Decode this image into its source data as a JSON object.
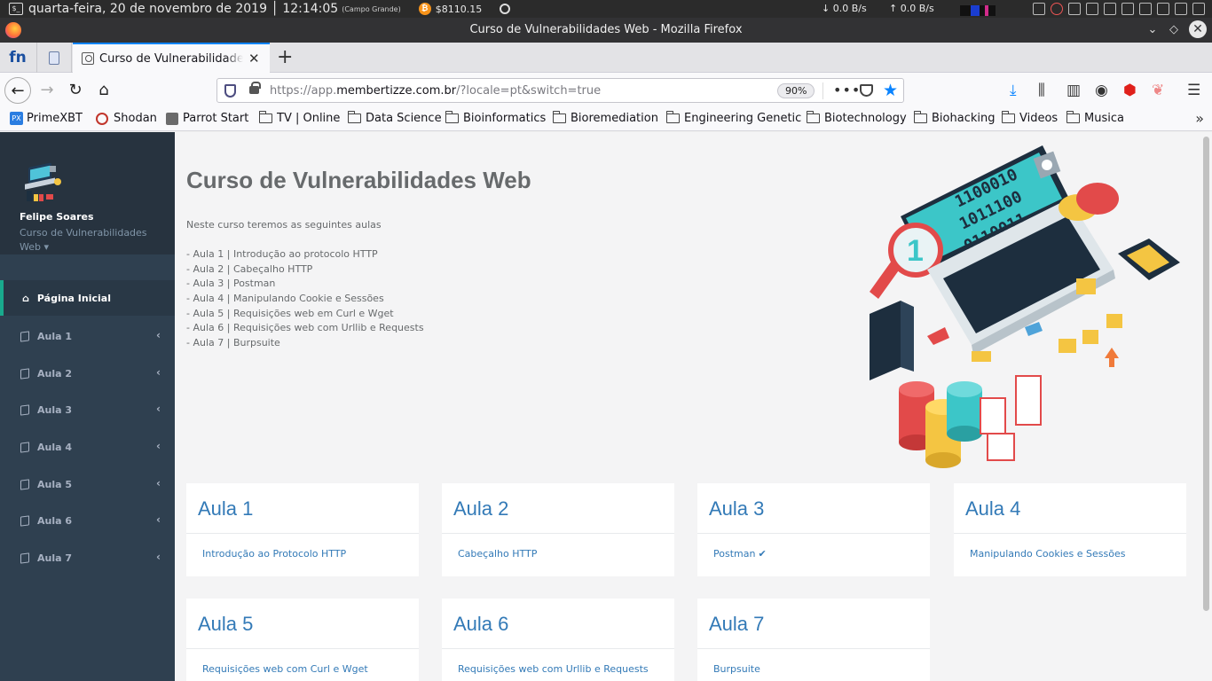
{
  "os_panel": {
    "datetime": "quarta-feira, 20 de novembro de 2019 │ 12:14:05",
    "timezone": "(Campo Grande)",
    "btc_value": "$8110.15",
    "net_down": "↓  0.0 B/s",
    "net_up": "↑  0.0 B/s"
  },
  "window": {
    "title": "Curso de Vulnerabilidades Web - Mozilla Firefox"
  },
  "tabs": {
    "pinned_fn_label": "fn",
    "active_title": "Curso de Vulnerabilidades Web",
    "close": "✕",
    "new_tab": "+"
  },
  "navbar": {
    "url_prefix": "https://app.",
    "url_domain": "membertizze.com.br",
    "url_path": "/?locale=pt&switch=true",
    "zoom": "90%",
    "more": "•••"
  },
  "bookmarks": [
    {
      "label": "PrimeXBT",
      "icon": "primexbt-icon"
    },
    {
      "label": "Shodan",
      "icon": "shodan-icon"
    },
    {
      "label": "Parrot Start",
      "icon": "parrot-icon"
    },
    {
      "label": "TV | Online",
      "icon": "folder-icon"
    },
    {
      "label": "Data Science",
      "icon": "folder-icon"
    },
    {
      "label": "Bioinformatics",
      "icon": "folder-icon"
    },
    {
      "label": "Bioremediation",
      "icon": "folder-icon"
    },
    {
      "label": "Engineering Genetic",
      "icon": "folder-icon"
    },
    {
      "label": "Biotechnology",
      "icon": "folder-icon"
    },
    {
      "label": "Biohacking",
      "icon": "folder-icon"
    },
    {
      "label": "Videos",
      "icon": "folder-icon"
    },
    {
      "label": "Musica",
      "icon": "folder-icon"
    }
  ],
  "sidebar": {
    "user_name": "Felipe Soares",
    "course_line1": "Curso de Vulnerabilidades",
    "course_line2": "Web ▾",
    "home_label": "Página Inicial",
    "items": [
      {
        "label": "Aula 1"
      },
      {
        "label": "Aula 2"
      },
      {
        "label": "Aula 3"
      },
      {
        "label": "Aula 4"
      },
      {
        "label": "Aula 5"
      },
      {
        "label": "Aula 6"
      },
      {
        "label": "Aula 7"
      }
    ],
    "chevron": "‹"
  },
  "main": {
    "title": "Curso de Vulnerabilidades Web",
    "intro": "Neste curso teremos as seguintes aulas",
    "lessons": [
      "- Aula 1 | Introdução ao protocolo HTTP",
      "- Aula 2 | Cabeçalho HTTP",
      "- Aula 3 | Postman",
      "- Aula 4 | Manipulando Cookie e Sessões",
      "- Aula 5 | Requisições web em Curl e Wget",
      "- Aula 6 | Requisições web com Urllib e Requests",
      "- Aula 7 | Burpsuite"
    ],
    "cards": [
      {
        "title": "Aula 1",
        "link": "Introdução ao Protocolo HTTP",
        "completed": false
      },
      {
        "title": "Aula 2",
        "link": "Cabeçalho HTTP",
        "completed": false
      },
      {
        "title": "Aula 3",
        "link": "Postman",
        "completed": true
      },
      {
        "title": "Aula 4",
        "link": "Manipulando Cookies e Sessões",
        "completed": false
      },
      {
        "title": "Aula 5",
        "link": "Requisições web com Curl e Wget",
        "completed": false
      },
      {
        "title": "Aula 6",
        "link": "Requisições web com Urllib e Requests",
        "completed": false
      },
      {
        "title": "Aula 7",
        "link": "Burpsuite",
        "completed": false
      }
    ],
    "check_mark": "✔"
  },
  "colors": {
    "sidebar_bg": "#2f4050",
    "sidebar_header_bg": "#27333f",
    "active_accent": "#19aa8d",
    "link_blue": "#337ab7",
    "title_gray": "#676a6c"
  }
}
